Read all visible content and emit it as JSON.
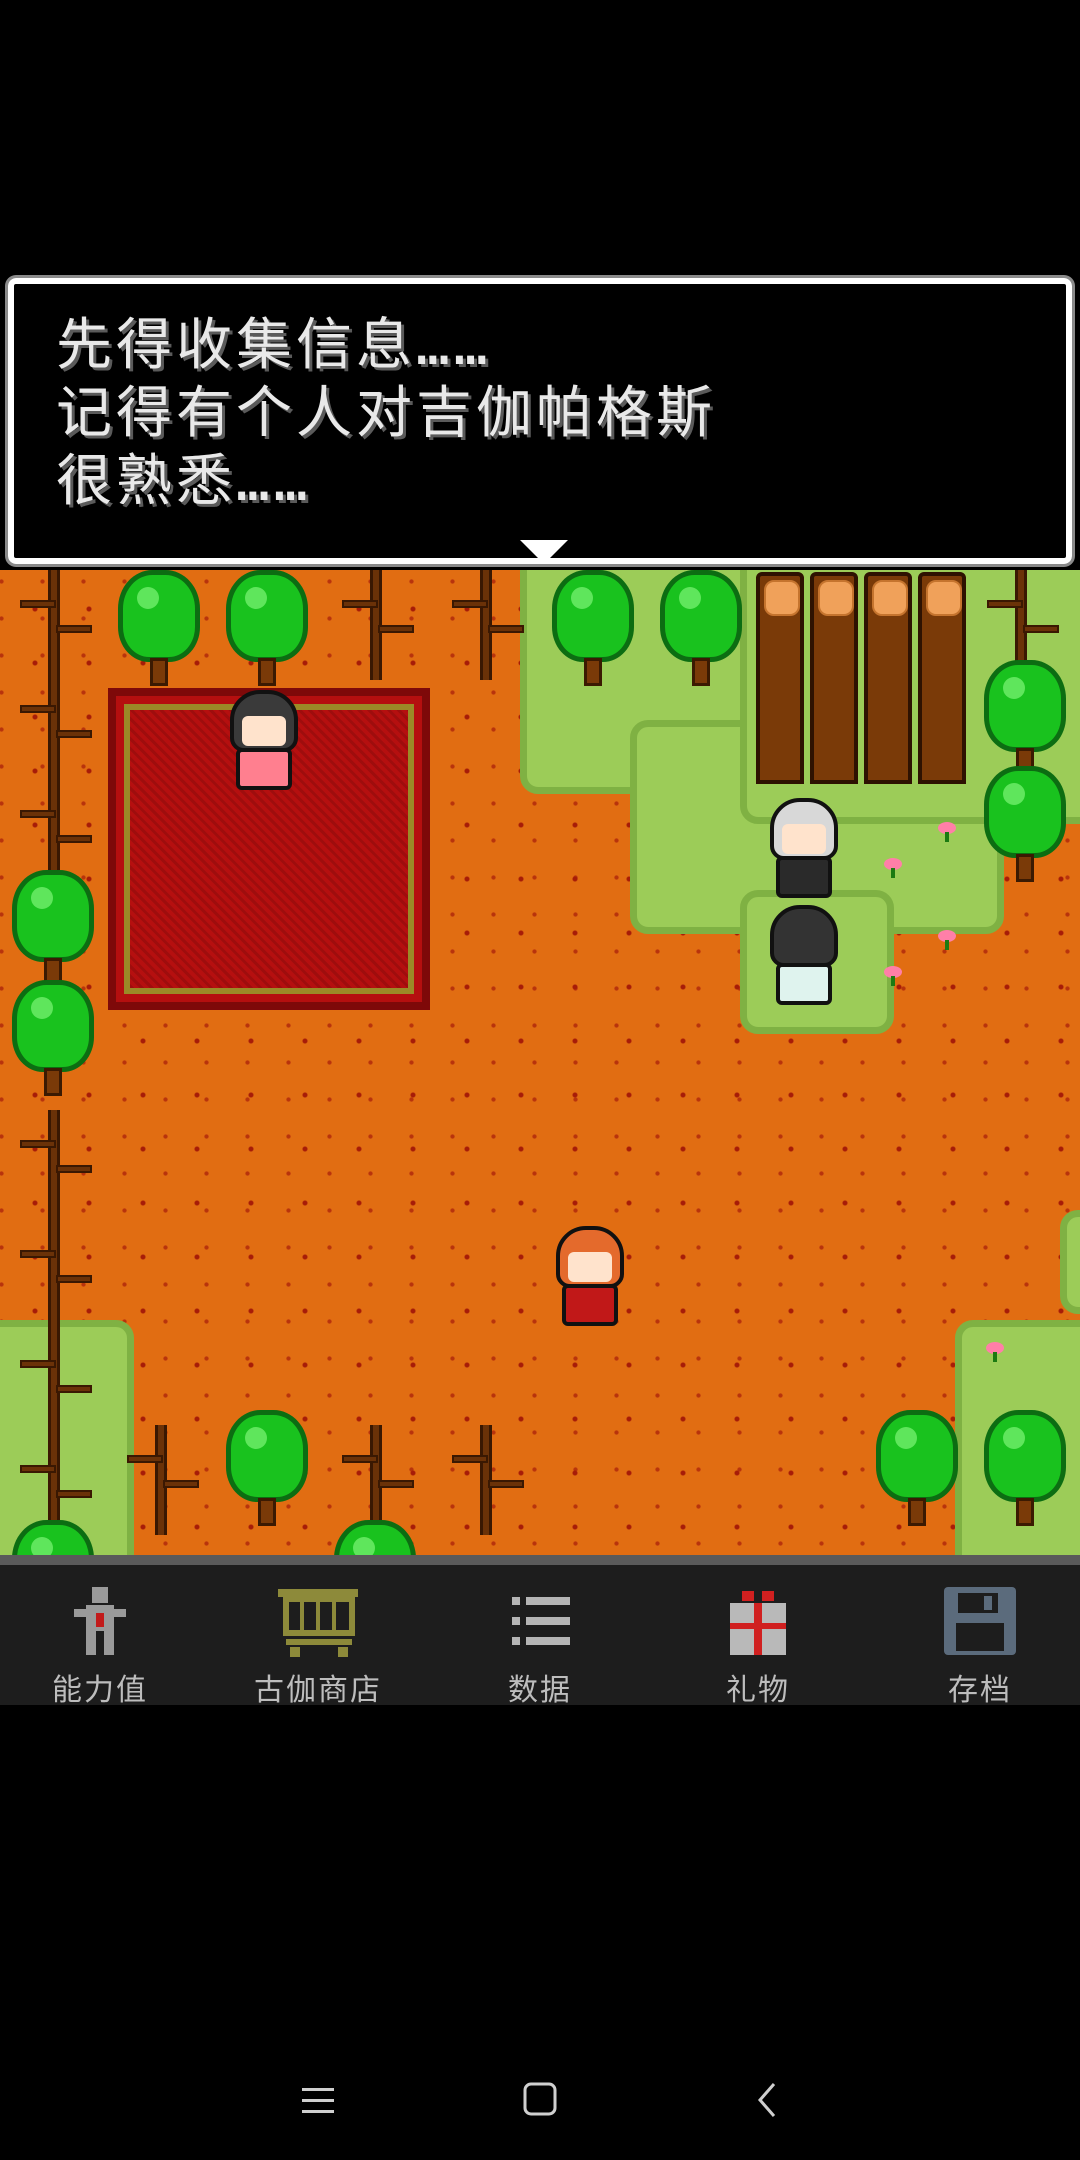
{
  "dialog": {
    "lines": [
      "先得收集信息……",
      "记得有个人对吉伽帕格斯",
      "很熟悉……"
    ]
  },
  "menu": {
    "items": [
      {
        "label": "能力值",
        "icon": "character-stats-icon"
      },
      {
        "label": "古伽商店",
        "icon": "shopping-cart-icon"
      },
      {
        "label": "数据",
        "icon": "list-icon"
      },
      {
        "label": "礼物",
        "icon": "gift-icon"
      },
      {
        "label": "存档",
        "icon": "floppy-disk-icon"
      }
    ]
  },
  "navbar": {
    "buttons": [
      "menu-icon",
      "home-square-icon",
      "back-chevron-icon"
    ]
  },
  "colors": {
    "ground": "#e16d12",
    "grass": "#9ccc58",
    "rug": "#b50f0f",
    "tree": "#19c21e",
    "menu_bg": "#1d1d1d",
    "dialog_text": "#e9e9e9",
    "cart": "#8d8a3a",
    "gift": "#b9b9b9",
    "floppy": "#5b6b7c"
  }
}
